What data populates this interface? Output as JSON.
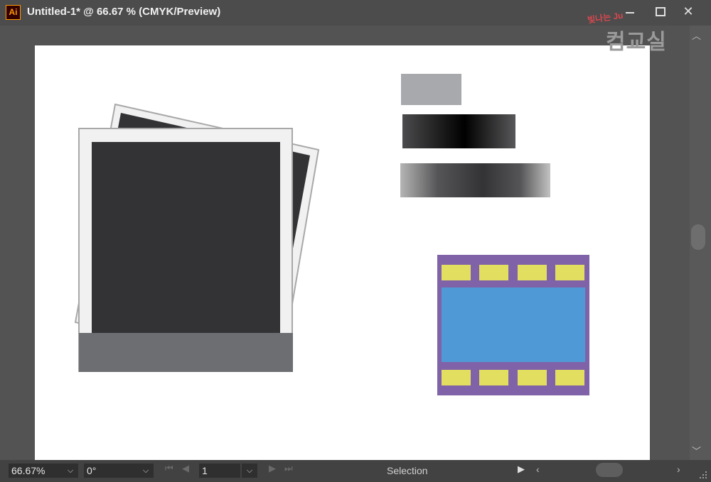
{
  "window": {
    "app_icon": "Ai",
    "title": "Untitled-1* @ 66.67 % (CMYK/Preview)",
    "minimize_icon": "minimize-icon",
    "maximize_icon": "maximize-icon",
    "close_icon": "close-icon",
    "close_glyph": "✕"
  },
  "watermark": {
    "line1": "빛나는 Ju",
    "line2": "컴교실"
  },
  "artwork": {
    "colors": {
      "photo_frame": "#f1f1f1",
      "photo_border": "#a8a8a8",
      "photo_dark": "#333336",
      "photo_bottom": "#6d6e71",
      "swatch_gray": "#a7a9ac",
      "film_purple": "#8062a8",
      "film_blue": "#4f9ad6",
      "film_yellow": "#e2df60"
    }
  },
  "statusbar": {
    "zoom": "66.67%",
    "rotation": "0°",
    "artboard_number": "1",
    "dropdown_glyph": "⌵",
    "first_glyph": "⏮",
    "prev_glyph": "◀",
    "next_glyph": "▶",
    "last_glyph": "⏭",
    "tool": "Selection",
    "play_glyph": "▶",
    "left_glyph": "‹",
    "right_glyph": "›",
    "up_glyph": "︿",
    "down_glyph": "﹀"
  }
}
